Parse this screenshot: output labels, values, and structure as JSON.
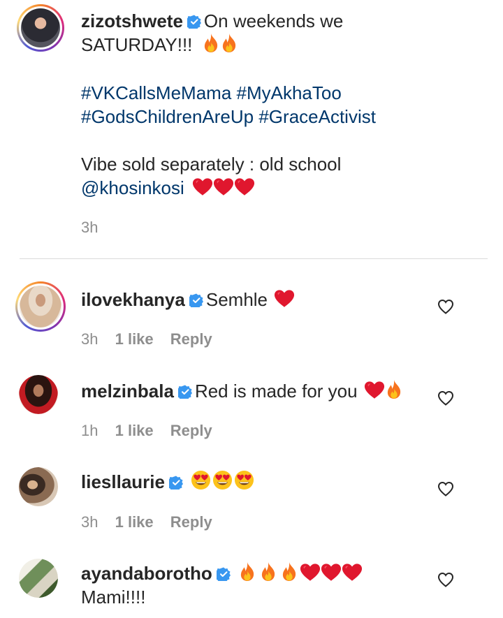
{
  "main_comment": {
    "username": "zizotshwete",
    "line1_text": "On weekends we",
    "line2_text": "SATURDAY!!!",
    "line2_emojis": "fire fire",
    "hashtags_line1": "#VKCallsMeMama #MyAkhaToo",
    "hashtags_line2": "#GodsChildrenAreUp #GraceActivist",
    "vibe_line": "Vibe sold separately : old school",
    "mention": "@khosinkosi",
    "mention_emojis": "heart heart heart",
    "time": "3h"
  },
  "replies": [
    {
      "username": "ilovekhanya",
      "text": "Semhle",
      "emojis": "heart",
      "time": "3h",
      "likes": "1 like",
      "reply_label": "Reply"
    },
    {
      "username": "melzinbala",
      "text": "Red is made for you",
      "emojis": "heart fire",
      "time": "1h",
      "likes": "1 like",
      "reply_label": "Reply"
    },
    {
      "username": "liesllaurie",
      "text": "",
      "emojis": "heart-eyes heart-eyes heart-eyes",
      "time": "3h",
      "likes": "1 like",
      "reply_label": "Reply"
    },
    {
      "username": "ayandaborotho",
      "text": "Mami!!!!",
      "emojis": "fire fire fire heart heart heart",
      "time": "",
      "likes": "",
      "reply_label": ""
    }
  ],
  "colors": {
    "text": "#262626",
    "secondary": "#8e8e8e",
    "link": "#00376b",
    "verified": "#3897f0",
    "heart_emoji": "#e0172e",
    "fire": "#f7731e"
  }
}
